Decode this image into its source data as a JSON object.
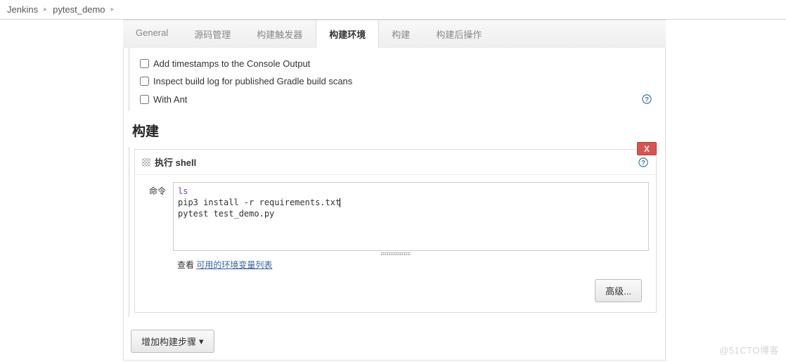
{
  "breadcrumb": {
    "root": "Jenkins",
    "project": "pytest_demo"
  },
  "tabs": [
    {
      "label": "General",
      "active": false
    },
    {
      "label": "源码管理",
      "active": false
    },
    {
      "label": "构建触发器",
      "active": false
    },
    {
      "label": "构建环境",
      "active": true
    },
    {
      "label": "构建",
      "active": false
    },
    {
      "label": "构建后操作",
      "active": false
    }
  ],
  "build_env_checks": [
    {
      "label": "Add timestamps to the Console Output",
      "help": false
    },
    {
      "label": "Inspect build log for published Gradle build scans",
      "help": false
    },
    {
      "label": "With Ant",
      "help": true
    }
  ],
  "section_build_title": "构建",
  "shell_step": {
    "title": "执行 shell",
    "delete_label": "X",
    "cmd_label": "命令",
    "command_lines": [
      "ls",
      "pip3 install -r requirements.txt",
      "pytest test_demo.py"
    ],
    "env_see_label": "查看 ",
    "env_link_label": "可用的环境变量列表",
    "advanced_label": "高级..."
  },
  "add_step_label": "增加构建步骤",
  "watermark": "@51CTO博客"
}
